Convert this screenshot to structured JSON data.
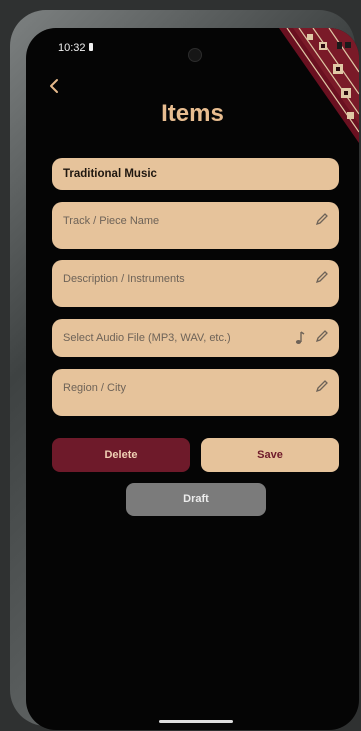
{
  "status_bar": {
    "time": "10:32"
  },
  "nav": {
    "back_icon": "chevron-left-icon"
  },
  "page": {
    "title": "Items"
  },
  "fields": [
    {
      "label": "Traditional Music",
      "icon": ""
    },
    {
      "label": "Track / Piece Name",
      "icon": "pencil-icon"
    },
    {
      "label": "Description / Instruments",
      "icon": "pencil-icon"
    },
    {
      "label": "Select Audio File (MP3, WAV, etc.)",
      "icon": "pencil-icon",
      "extra_icon": "music-note-icon"
    },
    {
      "label": "Region / City",
      "icon": "pencil-icon"
    }
  ],
  "buttons": {
    "delete": "Delete",
    "save": "Save",
    "draft": "Draft"
  },
  "colors": {
    "background": "#050505",
    "accent": "#e6c39b",
    "title": "#e8bd90",
    "delete": "#6e1a2a",
    "draft": "#7b7b7b"
  }
}
